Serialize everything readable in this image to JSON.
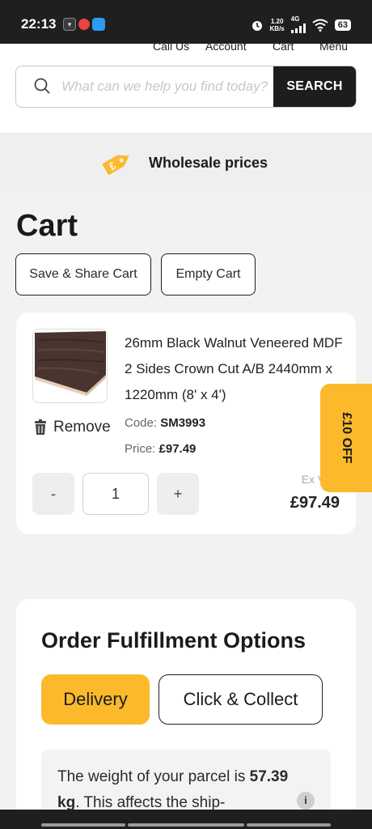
{
  "status_bar": {
    "time": "22:13",
    "net_speed": "1.20",
    "net_unit": "KB/s",
    "network": "4G",
    "battery": "63",
    "icons": [
      "app-icon-v",
      "app-icon-red",
      "app-icon-blue",
      "alarm-icon",
      "signal-icon",
      "wifi-icon",
      "battery-icon"
    ]
  },
  "top_nav": {
    "call_us": "Call Us",
    "account": "Account",
    "cart": "Cart",
    "menu": "Menu"
  },
  "search": {
    "placeholder": "What can we help you find today?",
    "value": "",
    "button_label": "SEARCH"
  },
  "promo": {
    "text": "Wholesale prices",
    "icon": "price-tag-icon",
    "color": "#fbb92b"
  },
  "cart": {
    "title": "Cart",
    "save_share_label": "Save & Share Cart",
    "empty_label": "Empty Cart",
    "item": {
      "name": "26mm Black Walnut Veneered MDF 2 Sides Crown Cut A/B 2440mm x 1220mm (8' x 4')",
      "remove_label": "Remove",
      "code_label": "Code:",
      "code": "SM3993",
      "price_label": "Price:",
      "price": "£97.49",
      "qty_minus": "-",
      "qty_plus": "+",
      "quantity": "1",
      "ex_vat": "Ex VAT",
      "total": "£97.49"
    }
  },
  "side_tab": {
    "label": "£10 OFF",
    "color": "#fbb92b"
  },
  "fulfillment": {
    "title": "Order Fulfillment Options",
    "delivery_label": "Delivery",
    "collect_label": "Click & Collect",
    "selected": "Delivery",
    "weight_prefix": "The weight of your parcel is ",
    "weight_value": "57.39 kg",
    "weight_suffix": ". This affects the ship-",
    "info_icon": "i"
  },
  "colors": {
    "accent": "#fbb92b",
    "dark": "#1d1d1d",
    "background": "#f2f2f2"
  }
}
